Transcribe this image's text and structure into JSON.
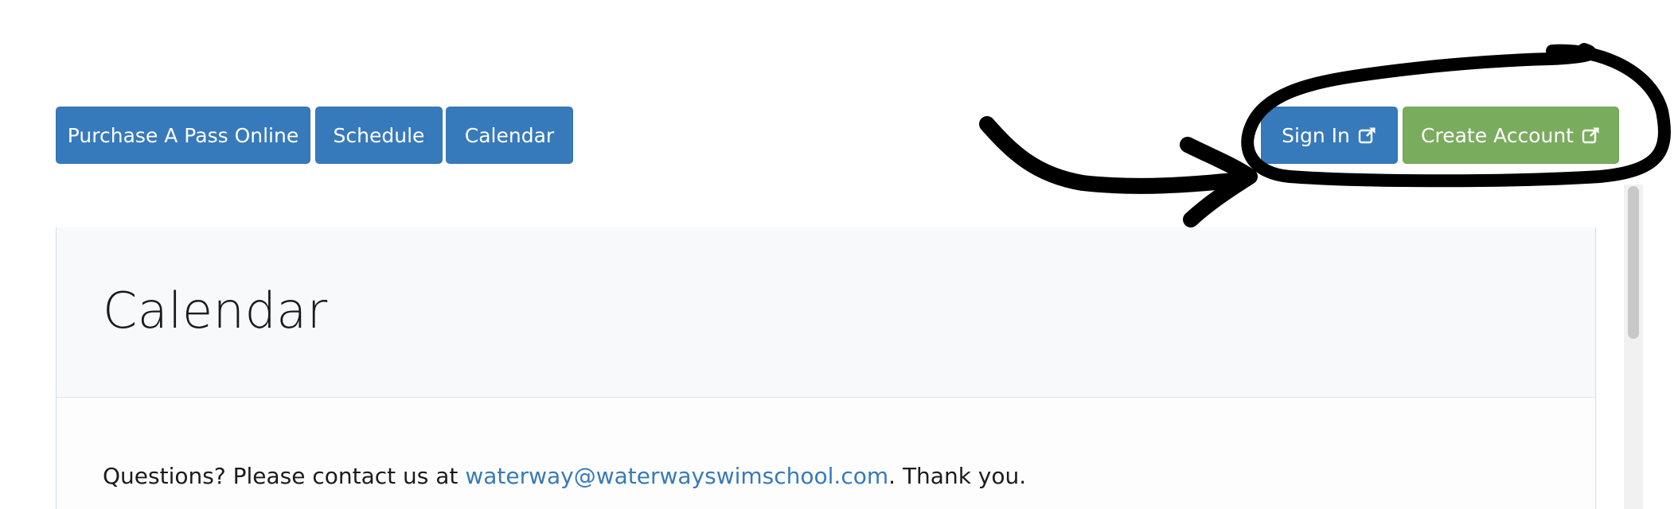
{
  "nav": {
    "purchase_label": "Purchase A Pass Online",
    "schedule_label": "Schedule",
    "calendar_label": "Calendar"
  },
  "account": {
    "sign_in_label": "Sign In",
    "create_account_label": "Create Account",
    "icon": "external-link-icon"
  },
  "panel": {
    "title": "Calendar",
    "contact_prefix": "Questions? Please contact us at ",
    "contact_email": "waterway@waterwayswimschool.com",
    "contact_suffix": ". Thank you."
  },
  "colors": {
    "primary": "#377abb",
    "success": "#7aac5e",
    "annotation": "#000000"
  }
}
